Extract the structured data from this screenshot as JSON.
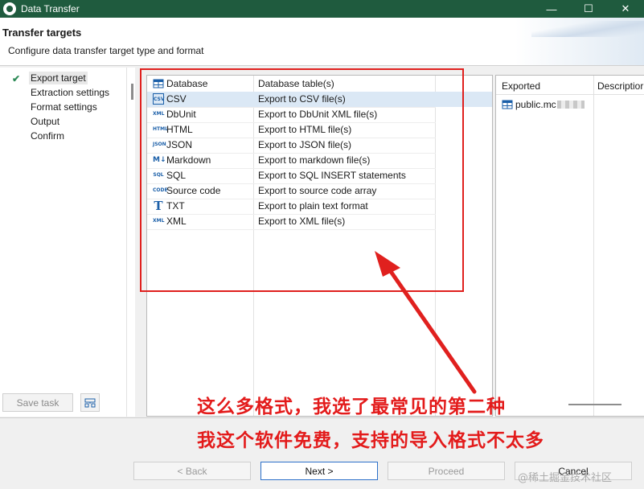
{
  "window": {
    "title": "Data Transfer",
    "controls": [
      "—",
      "☐",
      "✕"
    ]
  },
  "header": {
    "title": "Transfer targets",
    "subtitle": "Configure data transfer target type and format"
  },
  "nav": {
    "items": [
      {
        "label": "Export target",
        "selected": true,
        "done": true
      },
      {
        "label": "Extraction settings",
        "selected": false,
        "done": false
      },
      {
        "label": "Format settings",
        "selected": false,
        "done": false
      },
      {
        "label": "Output",
        "selected": false,
        "done": false
      },
      {
        "label": "Confirm",
        "selected": false,
        "done": false
      }
    ],
    "save_task_label": "Save task"
  },
  "formats": [
    {
      "name": "Database",
      "description": "Database table(s)",
      "icon": "database-icon"
    },
    {
      "name": "CSV",
      "description": "Export to CSV file(s)",
      "icon": "csv-icon",
      "selected": true
    },
    {
      "name": "DbUnit",
      "description": "Export to DbUnit XML file(s)",
      "icon": "dbunit-icon"
    },
    {
      "name": "HTML",
      "description": "Export to HTML file(s)",
      "icon": "html-icon"
    },
    {
      "name": "JSON",
      "description": "Export to JSON file(s)",
      "icon": "json-icon"
    },
    {
      "name": "Markdown",
      "description": "Export to markdown file(s)",
      "icon": "markdown-icon"
    },
    {
      "name": "SQL",
      "description": "Export to SQL INSERT statements",
      "icon": "sql-icon"
    },
    {
      "name": "Source code",
      "description": "Export to source code array",
      "icon": "code-icon"
    },
    {
      "name": "TXT",
      "description": "Export to plain text format",
      "icon": "txt-icon"
    },
    {
      "name": "XML",
      "description": "Export to XML file(s)",
      "icon": "xml-icon"
    }
  ],
  "exported_panel": {
    "col_exported": "Exported",
    "col_description": "Descriptior",
    "items": [
      {
        "name": "public.mc"
      }
    ]
  },
  "buttons": {
    "back": "< Back",
    "next": "Next >",
    "proceed": "Proceed",
    "cancel": "Cancel"
  },
  "annotations": {
    "line1": "这么多格式，我选了最常见的第二种",
    "line2": "我这个软件免费，支持的导入格式不太多"
  },
  "watermark": "@稀土掘金技术社区",
  "colors": {
    "titlebar": "#1f5b3e",
    "selection": "#dbe8f5",
    "annotation_red": "#e31b1b",
    "primary_border": "#2c70c9"
  }
}
